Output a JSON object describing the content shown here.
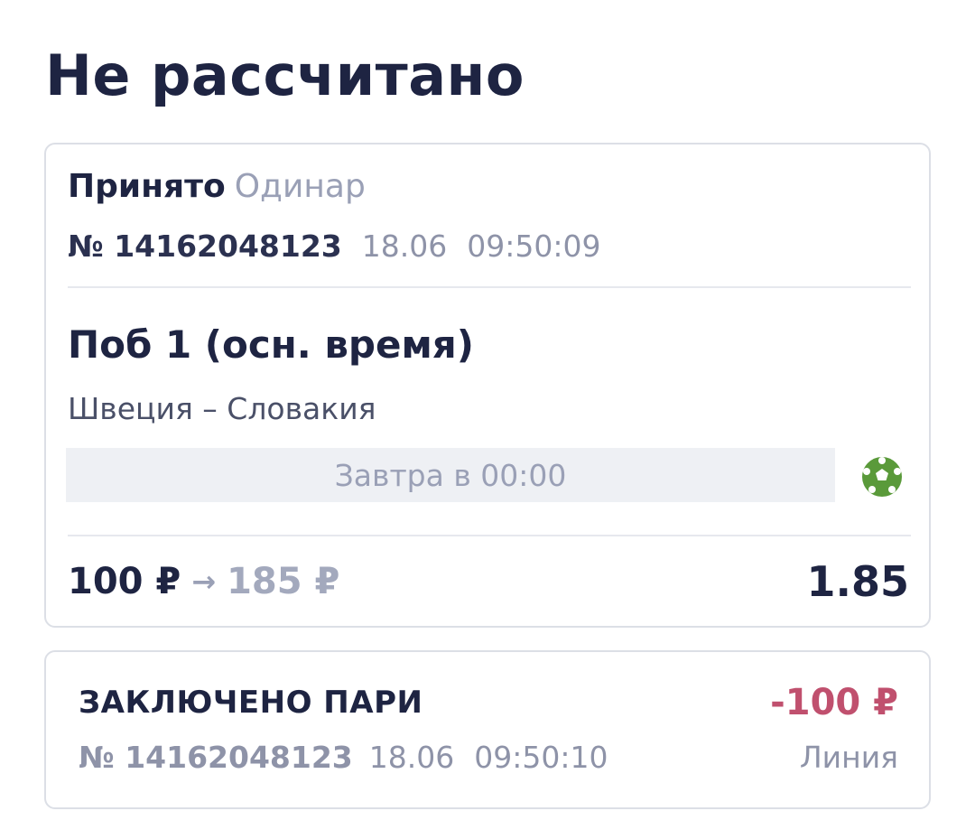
{
  "page": {
    "title": "Не рассчитано"
  },
  "bet": {
    "status": "Принято",
    "type": "Одинар",
    "number": "№ 14162048123",
    "date": "18.06",
    "time": "09:50:09",
    "outcome": "Поб 1 (осн. время)",
    "event": "Швеция – Словакия",
    "start_time": "Завтра в 00:00",
    "sport_icon": "football-icon",
    "stake": "100 ₽",
    "arrow": "→",
    "payout": "185 ₽",
    "odds": "1.85"
  },
  "pari": {
    "title": "ЗАКЛЮЧЕНО ПАРИ",
    "amount": "-100 ₽",
    "number": "№ 14162048123",
    "date": "18.06",
    "time": "09:50:10",
    "line_label": "Линия"
  },
  "colors": {
    "title": "#1e2442",
    "muted": "#9aa0b6",
    "negative_amount": "#c0506e",
    "sport_icon_green": "#5a9a3a",
    "start_box_bg": "#eef0f4"
  }
}
